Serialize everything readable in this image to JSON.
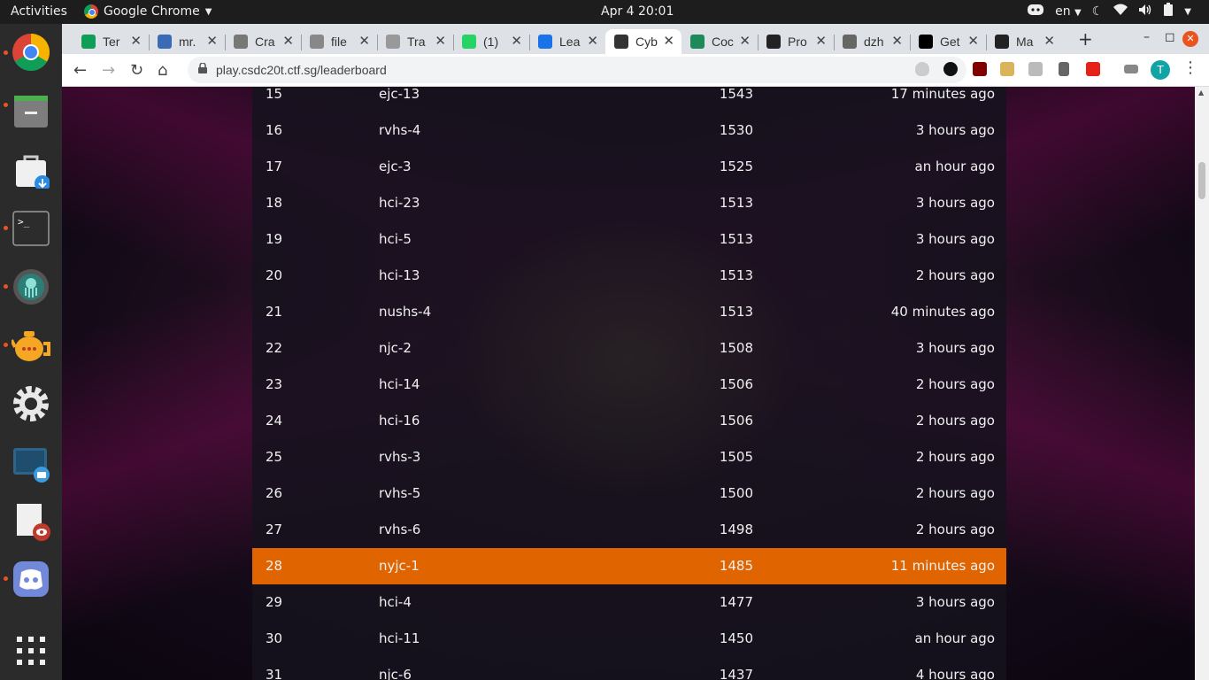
{
  "system": {
    "activities": "Activities",
    "app_name": "Google Chrome",
    "clock": "Apr 4  20:01",
    "language": "en"
  },
  "browser": {
    "tabs": [
      {
        "label": "Ter",
        "color": "#0f9d58"
      },
      {
        "label": "mr.",
        "color": "#3b6bb6"
      },
      {
        "label": "Cra",
        "color": "#777777"
      },
      {
        "label": "file",
        "color": "#888888"
      },
      {
        "label": "Tra",
        "color": "#999999"
      },
      {
        "label": "(1) ",
        "color": "#25d366"
      },
      {
        "label": "Lea",
        "color": "#1a73e8"
      },
      {
        "label": "Cyb",
        "color": "#333333"
      },
      {
        "label": "Coc",
        "color": "#1e8a5a"
      },
      {
        "label": "Pro",
        "color": "#222222"
      },
      {
        "label": "dzh",
        "color": "#666666"
      },
      {
        "label": "Get",
        "color": "#000000"
      },
      {
        "label": "Ma",
        "color": "#222222"
      }
    ],
    "active_tab_index": 7,
    "url": "play.csdc20t.ctf.sg/leaderboard",
    "profile_initial": "T"
  },
  "leaderboard": {
    "highlight_color": "#e06500",
    "rows": [
      {
        "rank": "15",
        "team": "ejc-13",
        "score": "1543",
        "time": "17 minutes ago"
      },
      {
        "rank": "16",
        "team": "rvhs-4",
        "score": "1530",
        "time": "3 hours ago"
      },
      {
        "rank": "17",
        "team": "ejc-3",
        "score": "1525",
        "time": "an hour ago"
      },
      {
        "rank": "18",
        "team": "hci-23",
        "score": "1513",
        "time": "3 hours ago"
      },
      {
        "rank": "19",
        "team": "hci-5",
        "score": "1513",
        "time": "3 hours ago"
      },
      {
        "rank": "20",
        "team": "hci-13",
        "score": "1513",
        "time": "2 hours ago"
      },
      {
        "rank": "21",
        "team": "nushs-4",
        "score": "1513",
        "time": "40 minutes ago"
      },
      {
        "rank": "22",
        "team": "njc-2",
        "score": "1508",
        "time": "3 hours ago"
      },
      {
        "rank": "23",
        "team": "hci-14",
        "score": "1506",
        "time": "2 hours ago"
      },
      {
        "rank": "24",
        "team": "hci-16",
        "score": "1506",
        "time": "2 hours ago"
      },
      {
        "rank": "25",
        "team": "rvhs-3",
        "score": "1505",
        "time": "2 hours ago"
      },
      {
        "rank": "26",
        "team": "rvhs-5",
        "score": "1500",
        "time": "2 hours ago"
      },
      {
        "rank": "27",
        "team": "rvhs-6",
        "score": "1498",
        "time": "2 hours ago"
      },
      {
        "rank": "28",
        "team": "nyjc-1",
        "score": "1485",
        "time": "11 minutes ago",
        "highlight": true
      },
      {
        "rank": "29",
        "team": "hci-4",
        "score": "1477",
        "time": "3 hours ago"
      },
      {
        "rank": "30",
        "team": "hci-11",
        "score": "1450",
        "time": "an hour ago"
      },
      {
        "rank": "31",
        "team": "njc-6",
        "score": "1437",
        "time": "4 hours ago"
      }
    ]
  }
}
